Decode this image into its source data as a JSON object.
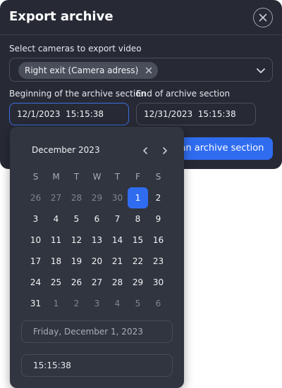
{
  "dialog": {
    "title": "Export archive",
    "cameras_label": "Select cameras to export video",
    "camera_chip": "Right exit (Camera adress)",
    "begin_label": "Beginning of the archive section",
    "end_label": "End of archive section",
    "begin_value": "12/1/2023  15:15:38",
    "end_value": "12/31/2023  15:15:38",
    "scan_button": "Scan archive section"
  },
  "calendar": {
    "month": "December 2023",
    "weekdays": [
      "S",
      "M",
      "T",
      "W",
      "T",
      "F",
      "S"
    ],
    "days": [
      {
        "d": "26",
        "m": true
      },
      {
        "d": "27",
        "m": true
      },
      {
        "d": "28",
        "m": true
      },
      {
        "d": "29",
        "m": true
      },
      {
        "d": "30",
        "m": true
      },
      {
        "d": "1",
        "sel": true
      },
      {
        "d": "2"
      },
      {
        "d": "3"
      },
      {
        "d": "4"
      },
      {
        "d": "5"
      },
      {
        "d": "6"
      },
      {
        "d": "7"
      },
      {
        "d": "8"
      },
      {
        "d": "9"
      },
      {
        "d": "10"
      },
      {
        "d": "11"
      },
      {
        "d": "12"
      },
      {
        "d": "13"
      },
      {
        "d": "14"
      },
      {
        "d": "15"
      },
      {
        "d": "16"
      },
      {
        "d": "17"
      },
      {
        "d": "18"
      },
      {
        "d": "19"
      },
      {
        "d": "20"
      },
      {
        "d": "21"
      },
      {
        "d": "22"
      },
      {
        "d": "23"
      },
      {
        "d": "24"
      },
      {
        "d": "25"
      },
      {
        "d": "26"
      },
      {
        "d": "27"
      },
      {
        "d": "28"
      },
      {
        "d": "29"
      },
      {
        "d": "30"
      },
      {
        "d": "31"
      },
      {
        "d": "1",
        "m": true
      },
      {
        "d": "2",
        "m": true
      },
      {
        "d": "3",
        "m": true
      },
      {
        "d": "4",
        "m": true
      },
      {
        "d": "5",
        "m": true
      },
      {
        "d": "6",
        "m": true
      }
    ],
    "selected_date_text": "Friday, December 1, 2023",
    "time_value": "15:15:38"
  },
  "icons": {
    "close": "close-icon",
    "chip_remove": "close-icon",
    "select": "chevron-down-icon",
    "prev": "chevron-left-icon",
    "next": "chevron-right-icon"
  },
  "colors": {
    "accent": "#2f6cf0",
    "dialog_bg": "#272a35",
    "calendar_bg": "#31353f"
  }
}
